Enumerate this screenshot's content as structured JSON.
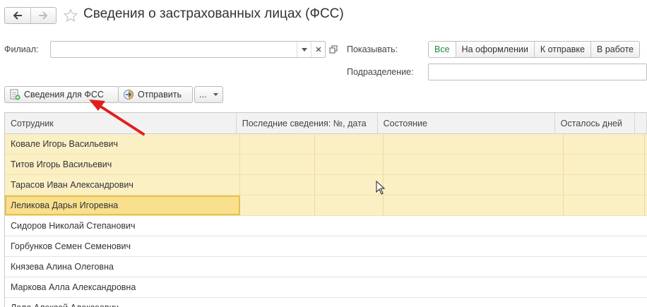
{
  "window": {
    "title": "Сведения о застрахованных лицах (ФСС)"
  },
  "filters": {
    "branch_label": "Филиал:",
    "branch_value": "",
    "show_label": "Показывать:",
    "show_options": [
      "Все",
      "На оформлении",
      "К отправке",
      "В работе"
    ],
    "show_selected": "Все",
    "department_label": "Подразделение:",
    "department_value": ""
  },
  "toolbar": {
    "fss_button": "Сведения для ФСС",
    "send_button": "Отправить",
    "more_button": "..."
  },
  "table": {
    "columns": [
      "Сотрудник",
      "Последние сведения: №, дата",
      "Состояние",
      "Осталось дней"
    ],
    "rows": [
      "Ковале Игорь Васильевич",
      "Титов Игорь Васильевич",
      "Тарасов Иван Александрович",
      "Леликова Дарья Игоревна",
      "Сидоров Николай Степанович",
      "Горбунков Семен Семенович",
      "Князева Алина Олеговна",
      "Маркова Алла Александровна",
      "Лоло Алексей Алексеевич"
    ],
    "highlighted_rows": 4,
    "selected_row": 3
  },
  "colors": {
    "highlight": "#fbefc4",
    "selected": "#f9e08e",
    "active_filter": "#1c8a3c",
    "arrow": "#e0201e"
  }
}
